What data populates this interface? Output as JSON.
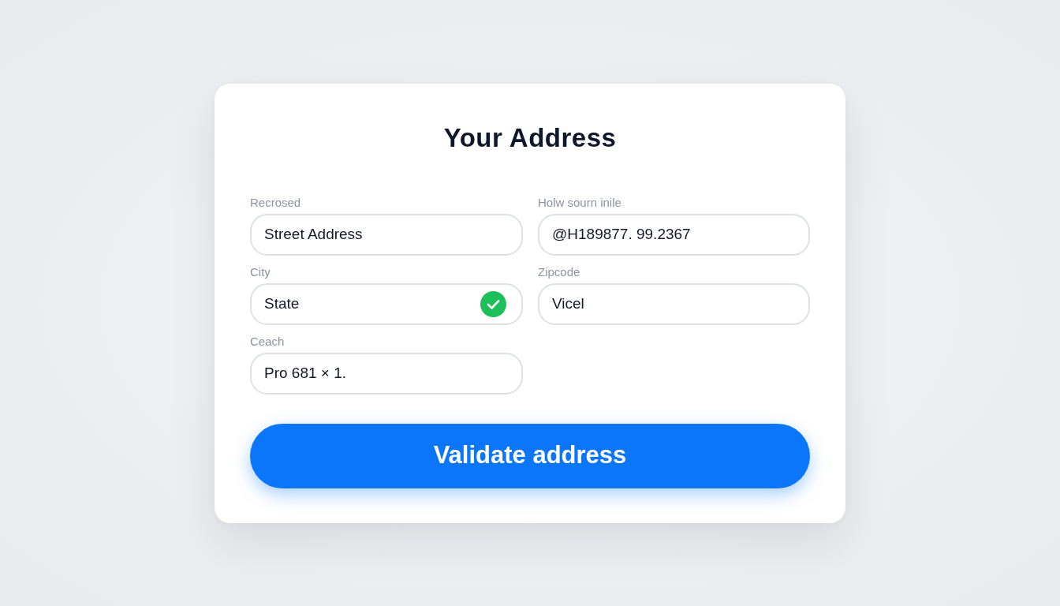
{
  "card": {
    "title": "Your Address"
  },
  "fields": [
    {
      "label": "Recrosed",
      "value": "Street Address",
      "valid": false
    },
    {
      "label": "Holw sourn inile",
      "value": "@H189877. 99.2367",
      "valid": false
    },
    {
      "label": "City",
      "value": "State",
      "valid": true
    },
    {
      "label": "Zipcode",
      "value": "Vicel",
      "valid": false
    },
    {
      "label": "Ceach",
      "value": "Pro 681 × 1.",
      "valid": false
    }
  ],
  "submit_button": {
    "label": "Validate address"
  }
}
